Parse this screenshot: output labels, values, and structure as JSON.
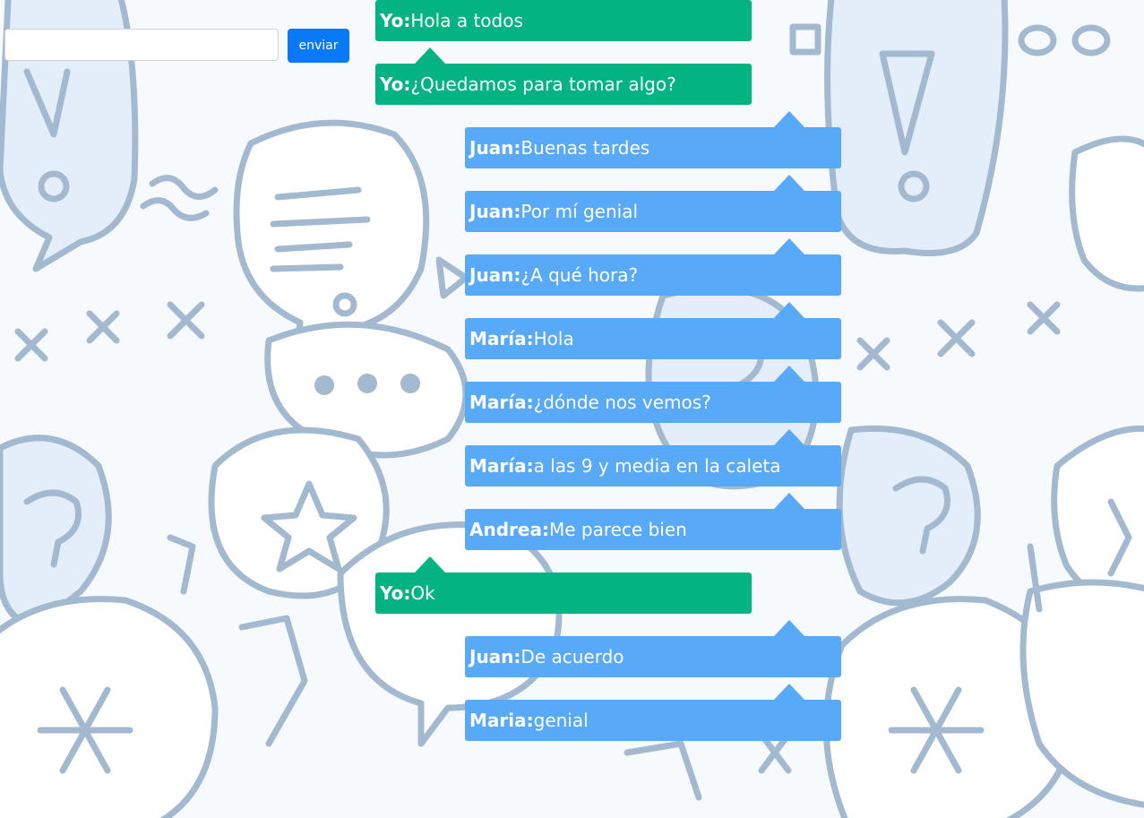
{
  "colors": {
    "my_bubble": "#03b482",
    "other_bubble": "#58a9f7",
    "send_button": "#0a79f7",
    "background_doodle_stroke": "#a3b9cf"
  },
  "compose": {
    "message_value": "",
    "message_placeholder": "",
    "send_label": "enviar"
  },
  "messages": [
    {
      "author": "Yo:",
      "text": "Hola a todos",
      "mine": true
    },
    {
      "author": "Yo:",
      "text": "¿Quedamos para tomar algo?",
      "mine": true
    },
    {
      "author": "Juan:",
      "text": "Buenas tardes",
      "mine": false
    },
    {
      "author": "Juan:",
      "text": "Por mí genial",
      "mine": false
    },
    {
      "author": "Juan:",
      "text": "¿A qué hora?",
      "mine": false
    },
    {
      "author": "María:",
      "text": "Hola",
      "mine": false
    },
    {
      "author": "María:",
      "text": "¿dónde nos vemos?",
      "mine": false
    },
    {
      "author": "María:",
      "text": "a las 9 y media en la caleta",
      "mine": false
    },
    {
      "author": "Andrea:",
      "text": "Me parece bien",
      "mine": false
    },
    {
      "author": "Yo:",
      "text": "Ok",
      "mine": true
    },
    {
      "author": "Juan:",
      "text": "De acuerdo",
      "mine": false
    },
    {
      "author": "Maria:",
      "text": "genial",
      "mine": false
    }
  ]
}
